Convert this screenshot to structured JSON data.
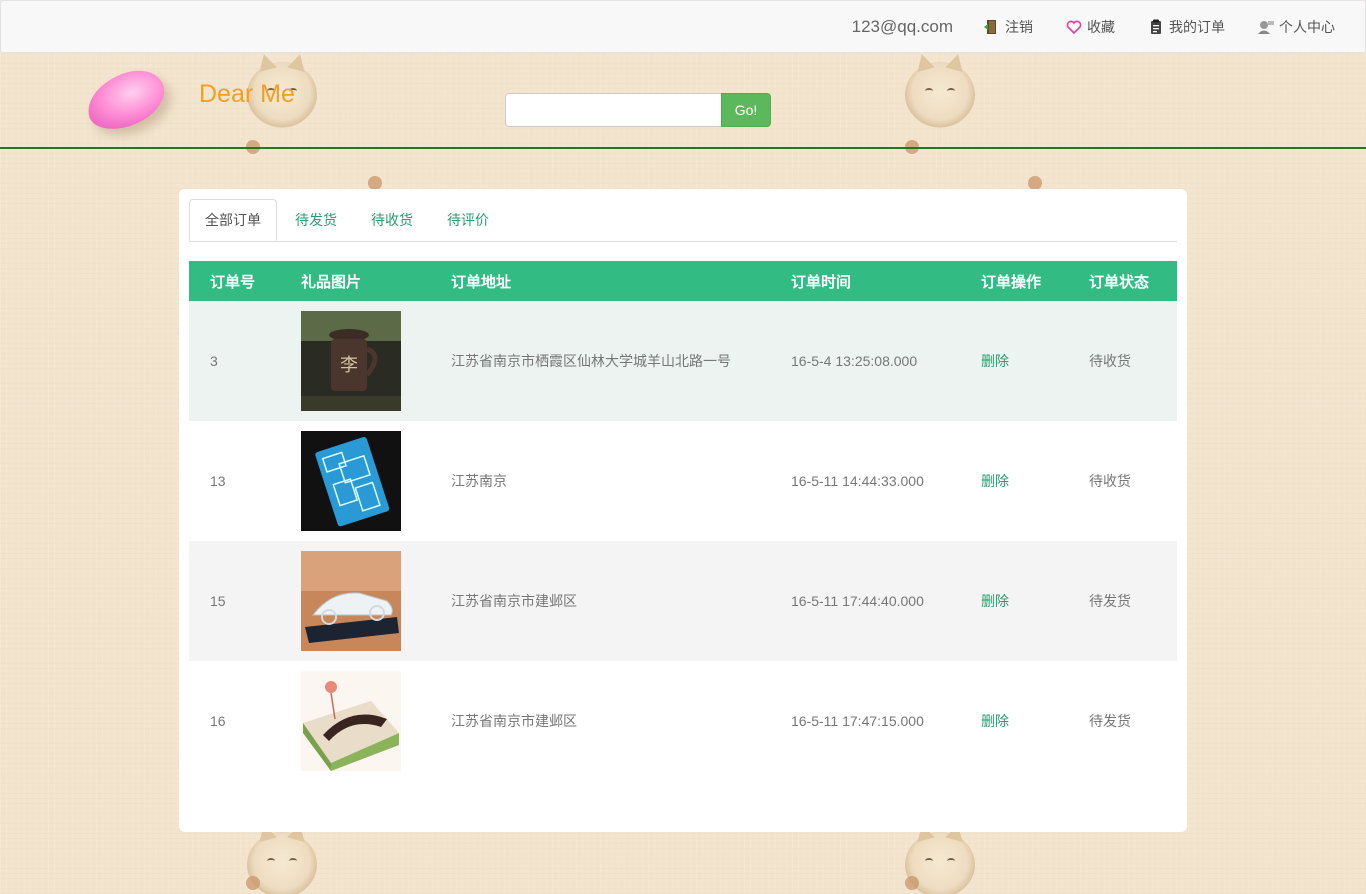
{
  "topbar": {
    "user_email": "123@qq.com",
    "links": [
      {
        "label": "注销",
        "icon": "logout-door-icon"
      },
      {
        "label": "收藏",
        "icon": "heart-icon"
      },
      {
        "label": "我的订单",
        "icon": "clipboard-icon"
      },
      {
        "label": "个人中心",
        "icon": "user-profile-icon"
      }
    ]
  },
  "header": {
    "brand": "Dear Me",
    "search": {
      "value": "",
      "placeholder": ""
    },
    "go_label": "Go!"
  },
  "tabs": [
    {
      "label": "全部订单",
      "active": true
    },
    {
      "label": "待发货",
      "active": false
    },
    {
      "label": "待收货",
      "active": false
    },
    {
      "label": "待评价",
      "active": false
    }
  ],
  "table": {
    "headers": [
      "订单号",
      "礼品图片",
      "订单地址",
      "订单时间",
      "订单操作",
      "订单状态"
    ],
    "rows": [
      {
        "id": "3",
        "image": "purple-clay-tea-mug",
        "address": "江苏省南京市栖霞区仙林大学城羊山北路一号",
        "time": "16-5-4 13:25:08.000",
        "action": "删除",
        "status": "待收货"
      },
      {
        "id": "13",
        "image": "blue-pattern-lighter",
        "address": "江苏南京",
        "time": "16-5-11 14:44:33.000",
        "action": "删除",
        "status": "待收货"
      },
      {
        "id": "15",
        "image": "crystal-car-model",
        "address": "江苏省南京市建邺区",
        "time": "16-5-11 17:44:40.000",
        "action": "删除",
        "status": "待发货"
      },
      {
        "id": "16",
        "image": "wooden-comb-gift-box",
        "address": "江苏省南京市建邺区",
        "time": "16-5-11 17:47:15.000",
        "action": "删除",
        "status": "待发货"
      }
    ]
  },
  "colors": {
    "background": "#f3e4ce",
    "header_rule": "#1f7a1f",
    "table_header": "#33bb84",
    "link": "#2a9d6f",
    "go_button": "#5cb85c",
    "brand": "#f0a020"
  }
}
